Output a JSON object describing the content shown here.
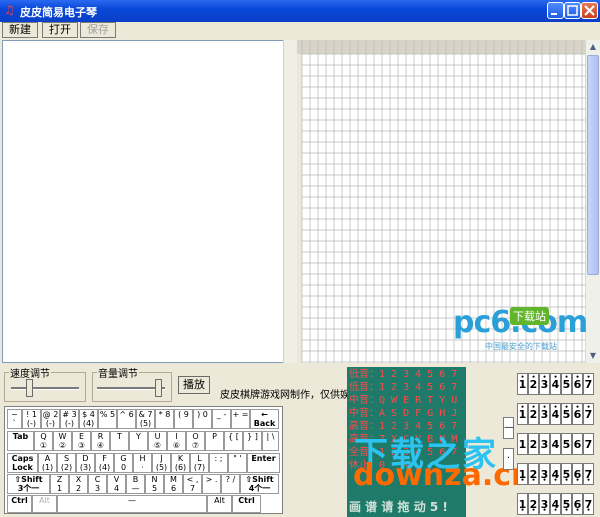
{
  "window": {
    "title": "皮皮简易电子琴"
  },
  "toolbar": {
    "new_label": "新建",
    "open_label": "打开",
    "save_label": "保存"
  },
  "controls": {
    "speed_label": "速度调节",
    "volume_label": "音量调节",
    "play_label": "播放",
    "credit": "皮皮棋牌游戏网制作，仅供娱乐",
    "speed_level": 0.25,
    "volume_level": 0.95
  },
  "keyboard": {
    "rows": [
      [
        {
          "top": "~",
          "bottom": "`"
        },
        {
          "top": "! 1",
          "bottom": "(-)"
        },
        {
          "top": "@ 2",
          "bottom": "(-)"
        },
        {
          "top": "# 3",
          "bottom": "(-)"
        },
        {
          "top": "$ 4",
          "bottom": "(4)"
        },
        {
          "top": "% 5",
          "bottom": ""
        },
        {
          "top": "^ 6",
          "bottom": ""
        },
        {
          "top": "& 7",
          "bottom": "(5)"
        },
        {
          "top": "* 8",
          "bottom": ""
        },
        {
          "top": "( 9",
          "bottom": ""
        },
        {
          "top": ") 0",
          "bottom": ""
        },
        {
          "top": "_ -",
          "bottom": ""
        },
        {
          "top": "+ =",
          "bottom": ""
        },
        {
          "top": "←",
          "bottom": "Back"
        }
      ],
      [
        {
          "top": "Tab",
          "bottom": ""
        },
        {
          "top": "Q",
          "bottom": "①"
        },
        {
          "top": "W",
          "bottom": "②"
        },
        {
          "top": "E",
          "bottom": "③"
        },
        {
          "top": "R",
          "bottom": "④"
        },
        {
          "top": "T",
          "bottom": ""
        },
        {
          "top": "Y",
          "bottom": ""
        },
        {
          "top": "U",
          "bottom": "⑤"
        },
        {
          "top": "I",
          "bottom": "⑥"
        },
        {
          "top": "O",
          "bottom": "⑦"
        },
        {
          "top": "P",
          "bottom": ""
        },
        {
          "top": "{ [",
          "bottom": ""
        },
        {
          "top": "} ]",
          "bottom": ""
        },
        {
          "top": "| \\",
          "bottom": ""
        }
      ],
      [
        {
          "top": "Caps",
          "bottom": "Lock"
        },
        {
          "top": "A",
          "bottom": "(1)"
        },
        {
          "top": "S",
          "bottom": "(2)"
        },
        {
          "top": "D",
          "bottom": "(3)"
        },
        {
          "top": "F",
          "bottom": "(4)"
        },
        {
          "top": "G",
          "bottom": "0"
        },
        {
          "top": "H",
          "bottom": "·"
        },
        {
          "top": "J",
          "bottom": "(5)"
        },
        {
          "top": "K",
          "bottom": "(6)"
        },
        {
          "top": "L",
          "bottom": "(7)"
        },
        {
          "top": ": ;",
          "bottom": ""
        },
        {
          "top": "\" '",
          "bottom": ""
        },
        {
          "top": "Enter",
          "bottom": ""
        }
      ],
      [
        {
          "top": "⇧Shift",
          "bottom": "3个一"
        },
        {
          "top": "Z",
          "bottom": "1"
        },
        {
          "top": "X",
          "bottom": "2"
        },
        {
          "top": "C",
          "bottom": "3"
        },
        {
          "top": "V",
          "bottom": "4"
        },
        {
          "top": "B",
          "bottom": "—"
        },
        {
          "top": "N",
          "bottom": "5"
        },
        {
          "top": "M",
          "bottom": "6"
        },
        {
          "top": "< ,",
          "bottom": "7"
        },
        {
          "top": "> .",
          "bottom": ""
        },
        {
          "top": "? /",
          "bottom": ""
        },
        {
          "top": "⇧Shift",
          "bottom": "4个一"
        }
      ],
      [
        {
          "top": "Ctrl",
          "bottom": ""
        },
        {
          "top": "Alt",
          "bottom": ""
        },
        {
          "top": "—",
          "bottom": ""
        },
        {
          "top": "Alt",
          "bottom": ""
        },
        {
          "top": "Ctrl",
          "bottom": ""
        }
      ]
    ]
  },
  "note_panel": {
    "lines": [
      "低音：1 2 3 4 5 6 7",
      "低音：1 2 3 4 5 6 7",
      "中音：Q W E R T Y U",
      "中音：A S D F G H J",
      "高音：1 2 3 4 5 6 7",
      "高音：Z X C V B N M",
      "全音：1 2 3 4 5 6 7",
      "休止：0   —"
    ],
    "hint": "画 谱 请 拖 动 5 !"
  },
  "side": {
    "minus_label": "—",
    "dot_label": "·"
  },
  "digit_rows": [
    {
      "digits": [
        "1",
        "2",
        "3",
        "4",
        "5",
        "6",
        "7"
      ],
      "dots_top": true,
      "dots_bottom": false
    },
    {
      "digits": [
        "1",
        "2",
        "3",
        "4",
        "5",
        "6",
        "7"
      ],
      "dots_top": true,
      "dots_bottom": false
    },
    {
      "digits": [
        "1",
        "2",
        "3",
        "4",
        "5",
        "6",
        "7"
      ],
      "dots_top": false,
      "dots_bottom": false
    },
    {
      "digits": [
        "1",
        "2",
        "3",
        "4",
        "5",
        "6",
        "7"
      ],
      "dots_top": false,
      "dots_bottom": true
    },
    {
      "digits": [
        "1",
        "2",
        "3",
        "4",
        "5",
        "6",
        "7"
      ],
      "dots_top": false,
      "dots_bottom": true
    }
  ],
  "watermarks": {
    "pc6_logo": "pc6.com",
    "pc6_badge": "下载站",
    "pc6_tagline": "中国最安全的下载站",
    "downza_cn": "下载之家",
    "downza_url": "downza.cn"
  }
}
